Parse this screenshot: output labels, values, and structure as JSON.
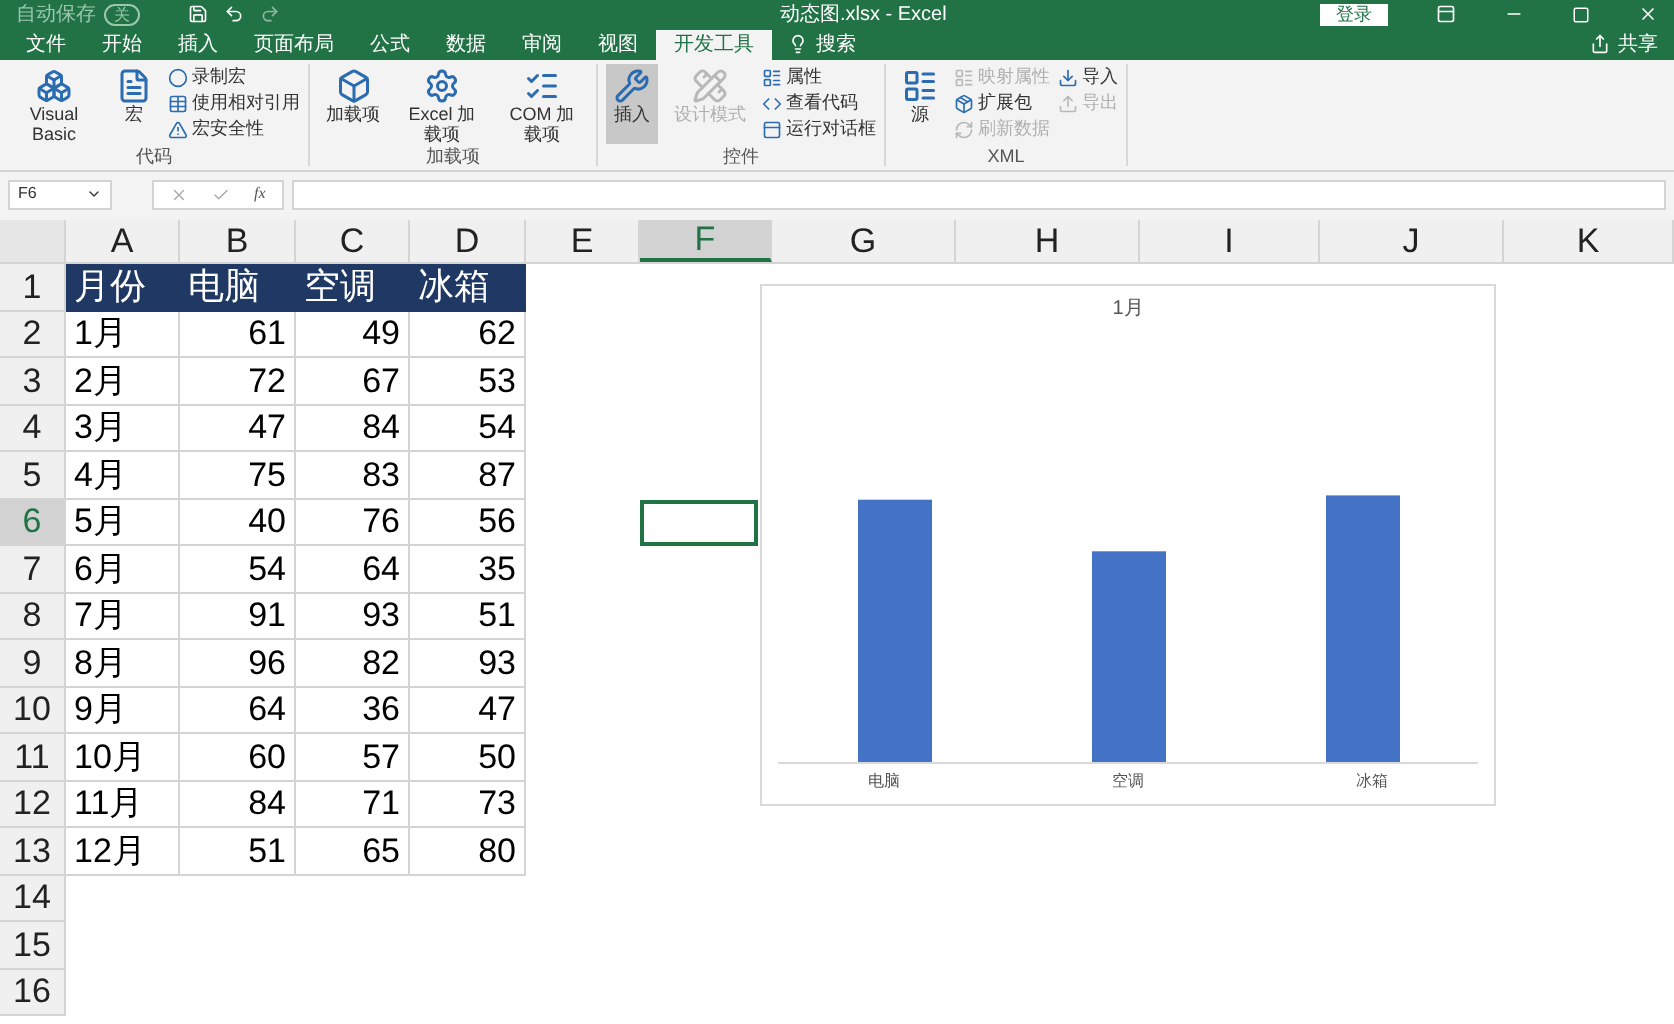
{
  "title_bar": {
    "autosave": "自动保存",
    "autosave_toggle": "关",
    "title": "动态图.xlsx - Excel",
    "sign_in": "登录"
  },
  "tabs": [
    {
      "label": "文件",
      "selected": false
    },
    {
      "label": "开始",
      "selected": false
    },
    {
      "label": "插入",
      "selected": false
    },
    {
      "label": "页面布局",
      "selected": false
    },
    {
      "label": "公式",
      "selected": false
    },
    {
      "label": "数据",
      "selected": false
    },
    {
      "label": "审阅",
      "selected": false
    },
    {
      "label": "视图",
      "selected": false
    },
    {
      "label": "开发工具",
      "selected": true
    }
  ],
  "tell_me": "搜索",
  "share": "共享",
  "ribbon": {
    "groups": [
      {
        "label": "代码",
        "items": [
          {
            "label": "Visual Basic",
            "kind": "large",
            "disabled": false,
            "pressed": false
          },
          {
            "label": "宏",
            "kind": "large",
            "disabled": false,
            "pressed": false
          },
          {
            "label": "录制宏",
            "kind": "small",
            "disabled": false,
            "pressed": false
          },
          {
            "label": "使用相对引用",
            "kind": "small",
            "disabled": false,
            "pressed": false
          },
          {
            "label": "宏安全性",
            "kind": "small",
            "disabled": false,
            "pressed": false
          }
        ]
      },
      {
        "label": "加载项",
        "items": [
          {
            "label": "加载项",
            "kind": "large",
            "disabled": false,
            "pressed": false
          },
          {
            "label": "Excel 加载项",
            "kind": "large",
            "disabled": false,
            "pressed": false
          },
          {
            "label": "COM 加载项",
            "kind": "large",
            "disabled": false,
            "pressed": false
          }
        ]
      },
      {
        "label": "控件",
        "items": [
          {
            "label": "插入",
            "kind": "large",
            "disabled": false,
            "pressed": true
          },
          {
            "label": "设计模式",
            "kind": "large",
            "disabled": true,
            "pressed": false
          },
          {
            "label": "属性",
            "kind": "small",
            "disabled": false,
            "pressed": false
          },
          {
            "label": "查看代码",
            "kind": "small",
            "disabled": false,
            "pressed": false
          },
          {
            "label": "运行对话框",
            "kind": "small",
            "disabled": false,
            "pressed": false
          }
        ]
      },
      {
        "label": "XML",
        "items": [
          {
            "label": "源",
            "kind": "large",
            "disabled": false,
            "pressed": false
          },
          {
            "label": "映射属性",
            "kind": "small",
            "disabled": true,
            "pressed": false
          },
          {
            "label": "扩展包",
            "kind": "small",
            "disabled": false,
            "pressed": false
          },
          {
            "label": "刷新数据",
            "kind": "small",
            "disabled": true,
            "pressed": false
          },
          {
            "label": "导入",
            "kind": "small",
            "disabled": false,
            "pressed": false
          },
          {
            "label": "导出",
            "kind": "small",
            "disabled": true,
            "pressed": false
          }
        ]
      }
    ]
  },
  "formula_bar": {
    "name_box": "F6",
    "function_label": "fx"
  },
  "sheet": {
    "columns": [
      {
        "label": "A",
        "selected": false
      },
      {
        "label": "B",
        "selected": false
      },
      {
        "label": "C",
        "selected": false
      },
      {
        "label": "D",
        "selected": false
      },
      {
        "label": "E",
        "selected": false
      },
      {
        "label": "F",
        "selected": true
      },
      {
        "label": "G",
        "selected": false
      },
      {
        "label": "H",
        "selected": false
      },
      {
        "label": "I",
        "selected": false
      },
      {
        "label": "J",
        "selected": false
      },
      {
        "label": "K",
        "selected": false
      }
    ],
    "rows": [
      {
        "label": "1",
        "selected": false
      },
      {
        "label": "2",
        "selected": false
      },
      {
        "label": "3",
        "selected": false
      },
      {
        "label": "4",
        "selected": false
      },
      {
        "label": "5",
        "selected": false
      },
      {
        "label": "6",
        "selected": true
      },
      {
        "label": "7",
        "selected": false
      },
      {
        "label": "8",
        "selected": false
      },
      {
        "label": "9",
        "selected": false
      },
      {
        "label": "10",
        "selected": false
      },
      {
        "label": "11",
        "selected": false
      },
      {
        "label": "12",
        "selected": false
      },
      {
        "label": "13",
        "selected": false
      },
      {
        "label": "14",
        "selected": false
      },
      {
        "label": "15",
        "selected": false
      },
      {
        "label": "16",
        "selected": false
      }
    ],
    "table": {
      "header": [
        "月份",
        "电脑",
        "空调",
        "冰箱"
      ],
      "rows": [
        [
          "1月",
          "61",
          "49",
          "62"
        ],
        [
          "2月",
          "72",
          "67",
          "53"
        ],
        [
          "3月",
          "47",
          "84",
          "54"
        ],
        [
          "4月",
          "75",
          "83",
          "87"
        ],
        [
          "5月",
          "40",
          "76",
          "56"
        ],
        [
          "6月",
          "54",
          "64",
          "35"
        ],
        [
          "7月",
          "91",
          "93",
          "51"
        ],
        [
          "8月",
          "96",
          "82",
          "93"
        ],
        [
          "9月",
          "64",
          "36",
          "47"
        ],
        [
          "10月",
          "60",
          "57",
          "50"
        ],
        [
          "11月",
          "84",
          "71",
          "73"
        ],
        [
          "12月",
          "51",
          "65",
          "80"
        ]
      ]
    }
  },
  "chart": {
    "title": "1月",
    "categories": [
      "电脑",
      "空调",
      "冰箱"
    ]
  }
}
